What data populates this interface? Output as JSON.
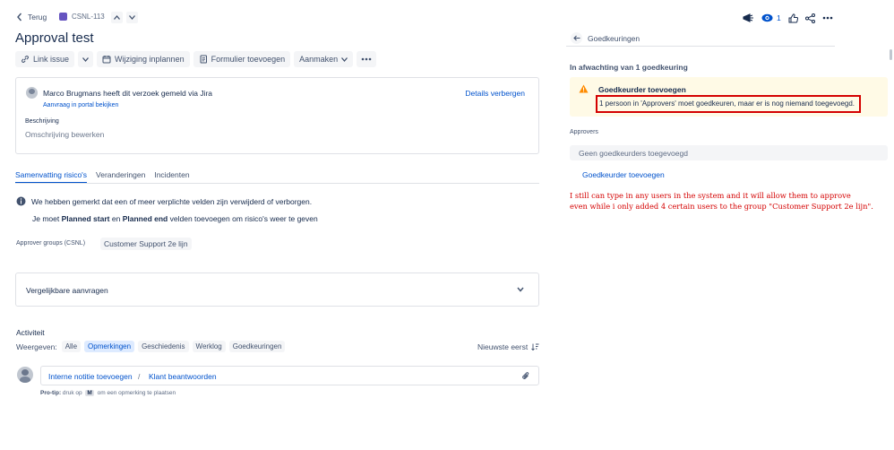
{
  "header": {
    "back_label": "Terug",
    "issue_key": "CSNL-113",
    "title": "Approval test",
    "watch_count": "1"
  },
  "toolbar": {
    "link_issue": "Link issue",
    "schedule_change": "Wijziging inplannen",
    "add_form": "Formulier toevoegen",
    "create": "Aanmaken"
  },
  "request": {
    "reporter_name": "Marco Brugmans",
    "reported_text": "heeft dit verzoek gemeld via",
    "channel": "Jira",
    "portal_link": "Aanvraag in portal bekijken",
    "hide_details": "Details verbergen",
    "description_label": "Beschrijving",
    "description_placeholder": "Omschrijving bewerken"
  },
  "tabs": [
    "Samenvatting risico's",
    "Veranderingen",
    "Incidenten"
  ],
  "notice": {
    "line1": "We hebben gemerkt dat een of meer verplichte velden zijn verwijderd of verborgen.",
    "line2_pre": "Je moet",
    "field1": "Planned start",
    "and": "en",
    "field2": "Planned end",
    "line2_post": "velden toevoegen om risico's weer te geven"
  },
  "approver_groups": {
    "label": "Approver groups (CSNL)",
    "value": "Customer Support 2e lijn"
  },
  "similar_requests": "Vergelijkbare aanvragen",
  "activity": {
    "title": "Activiteit",
    "show_label": "Weergeven:",
    "filters": [
      "Alle",
      "Opmerkingen",
      "Geschiedenis",
      "Werklog",
      "Goedkeuringen"
    ],
    "sort": "Nieuwste eerst",
    "internal_note": "Interne notitie toevoegen",
    "separator": "/",
    "reply": "Klant beantwoorden",
    "protip_bold": "Pro-tip:",
    "protip_pre": "druk op",
    "protip_key": "M",
    "protip_post": "om een opmerking te plaatsen"
  },
  "approvals": {
    "title": "Goedkeuringen",
    "pending": "In afwachting van 1 goedkeuring",
    "warning_title": "Goedkeurder toevoegen",
    "warning_text": "1 persoon in 'Approvers' moet goedkeuren, maar er is nog niemand toegevoegd.",
    "approvers_label": "Approvers",
    "no_approvers": "Geen goedkeurders toegevoegd",
    "add_approver": "Goedkeurder toevoegen"
  },
  "annotation": {
    "line1": "I still can type in any users in the system and it will allow them to approve",
    "line2": "even while i only added 4 certain users to the group \"Customer Support 2e lijn\"."
  },
  "colors": {
    "accent": "#0052cc",
    "warning_bg": "#fffae6",
    "warning_icon": "#ff8b00",
    "annotation_red": "#d40000",
    "issue_type": "#6554c0"
  }
}
